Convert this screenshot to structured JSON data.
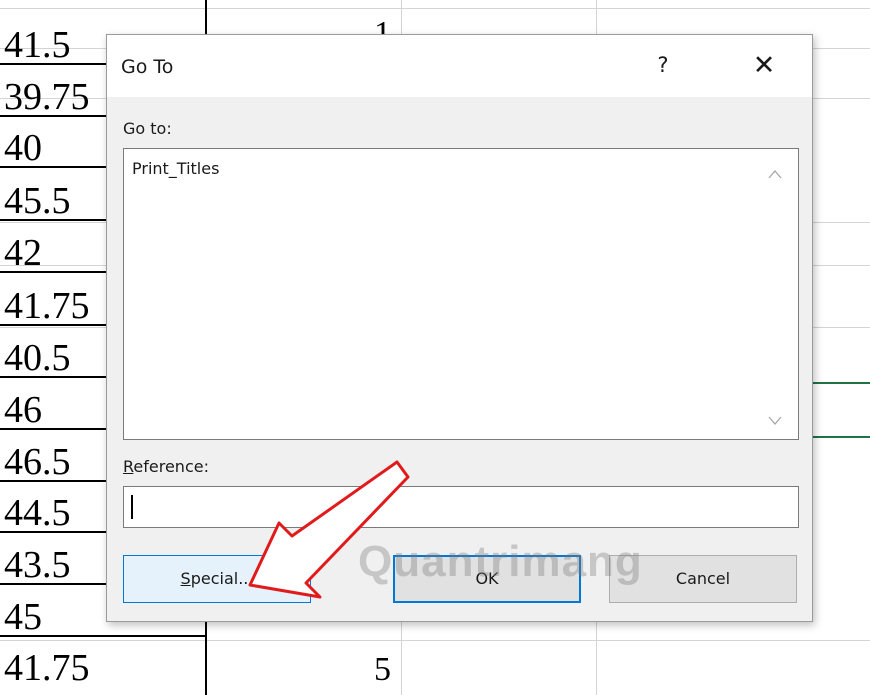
{
  "sheet": {
    "col_a_values": [
      "41.5",
      "39.75",
      "40",
      "45.5",
      "42",
      "41.75",
      "40.5",
      "46",
      "46.5",
      "44.5",
      "43.5",
      "45",
      "41.75"
    ],
    "col_b_values": {
      "first": "1",
      "last": "5"
    }
  },
  "dialog": {
    "title": "Go To",
    "help_label": "?",
    "close_label": "✕",
    "goto_label": "Go to:",
    "list_items": [
      "Print_Titles"
    ],
    "scroll_up_icon": "chevron-up-icon",
    "scroll_down_icon": "chevron-down-icon",
    "reference_label_accel": "R",
    "reference_label_rest": "eference:",
    "reference_value": "",
    "special_accel": "S",
    "special_rest": "pecial...",
    "ok_label": "OK",
    "cancel_label": "Cancel"
  },
  "watermark": "Quantrimang",
  "colors": {
    "accent": "#0078d7",
    "annotation_arrow": "#e11b1b",
    "selection_border": "#217346"
  }
}
